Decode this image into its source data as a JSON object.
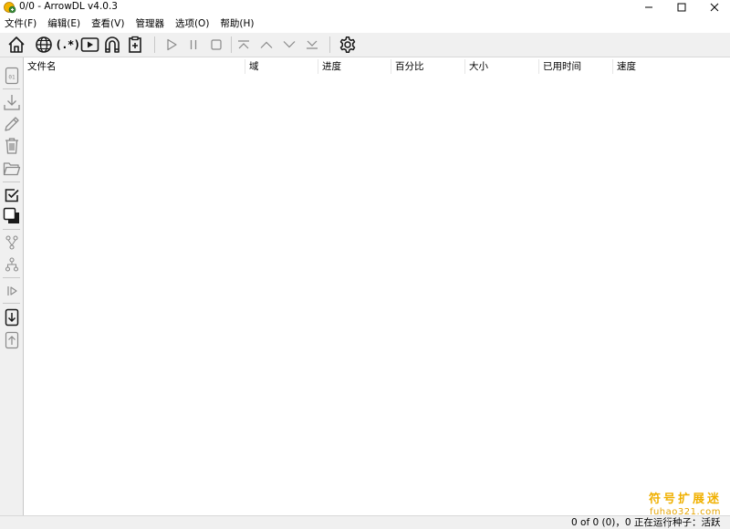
{
  "window": {
    "title": "0/0 - ArrowDL v4.0.3"
  },
  "menu": [
    "文件(F)",
    "编辑(E)",
    "查看(V)",
    "管理器",
    "选项(O)",
    "帮助(H)"
  ],
  "table": {
    "columns": [
      "文件名",
      "域",
      "进度",
      "百分比",
      "大小",
      "已用时间",
      "速度"
    ],
    "rows": []
  },
  "status": {
    "left": "0 of 0 (0)，0 正在运行",
    "right": "种子：活跃"
  },
  "watermark": {
    "main": "符号扩展迷",
    "sub": "fuhao321.com"
  },
  "colors": {
    "chrome": "#f0f0f0",
    "watermark": "#f0b000",
    "icon": "#1a1a1a",
    "disabled_icon": "#8a8a8a"
  }
}
